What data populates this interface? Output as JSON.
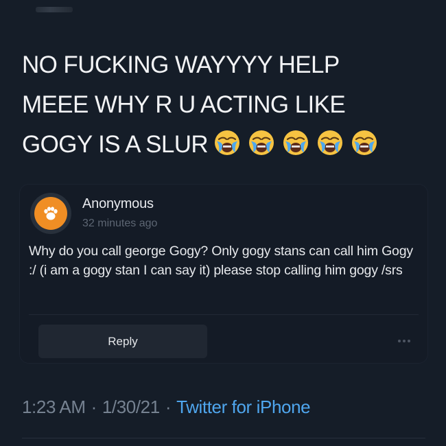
{
  "tweet": {
    "lines": [
      "NO FUCKING WAYYYY HELP",
      "MEEE WHY R U ACTING LIKE",
      "GOGY IS A SLUR"
    ],
    "emoji": [
      "loudly-crying-face-icon",
      "loudly-crying-face-icon",
      "loudly-crying-face-icon",
      "loudly-crying-face-icon",
      "loudly-crying-face-icon"
    ],
    "time": "1:23 AM",
    "date": "1/30/21",
    "source": "Twitter for iPhone",
    "separator": "·"
  },
  "card": {
    "sender": "Anonymous",
    "time_ago": "32 minutes ago",
    "avatar_icon": "paw-print-icon",
    "message": "Why do you call george Gogy? Only gogy stans can call him Gogy :/ (i am a gogy stan I can say it) please stop calling him gogy /srs",
    "reply_label": "Reply",
    "more_icon": "more-options-icon"
  },
  "colors": {
    "background": "#151d28",
    "card": "#141b26",
    "avatar": "#f08e24",
    "link": "#4fa6ee",
    "muted": "#768291"
  }
}
